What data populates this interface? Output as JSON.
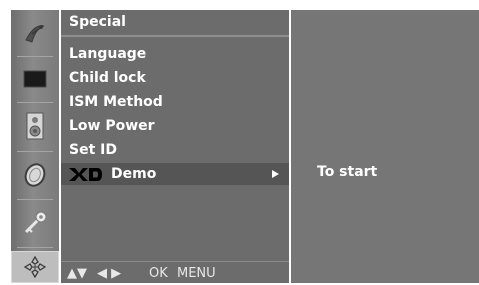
{
  "menu": {
    "title": "Special",
    "items": [
      {
        "label": "Language"
      },
      {
        "label": "Child lock"
      },
      {
        "label": "ISM Method"
      },
      {
        "label": "Low Power"
      },
      {
        "label": "Set ID"
      },
      {
        "label": "Demo",
        "prefix_logo": "XD",
        "selected": true
      }
    ],
    "nav_hint": {
      "updown": "▲▼",
      "leftright": "◀ ▶",
      "ok": "OK",
      "menu": "MENU"
    }
  },
  "submenu": {
    "label": "To start"
  },
  "icons": [
    {
      "name": "satellite-dish-icon"
    },
    {
      "name": "picture-screen-icon"
    },
    {
      "name": "speaker-sound-icon"
    },
    {
      "name": "clock-time-icon"
    },
    {
      "name": "key-lock-icon"
    },
    {
      "name": "special-options-icon",
      "active": true
    }
  ],
  "colors": {
    "panel": "#6c6c6c",
    "selected_row": "#555555",
    "submenu_panel": "#767676",
    "active_icon_bg": "#bdbdbd",
    "text": "#ffffff"
  }
}
